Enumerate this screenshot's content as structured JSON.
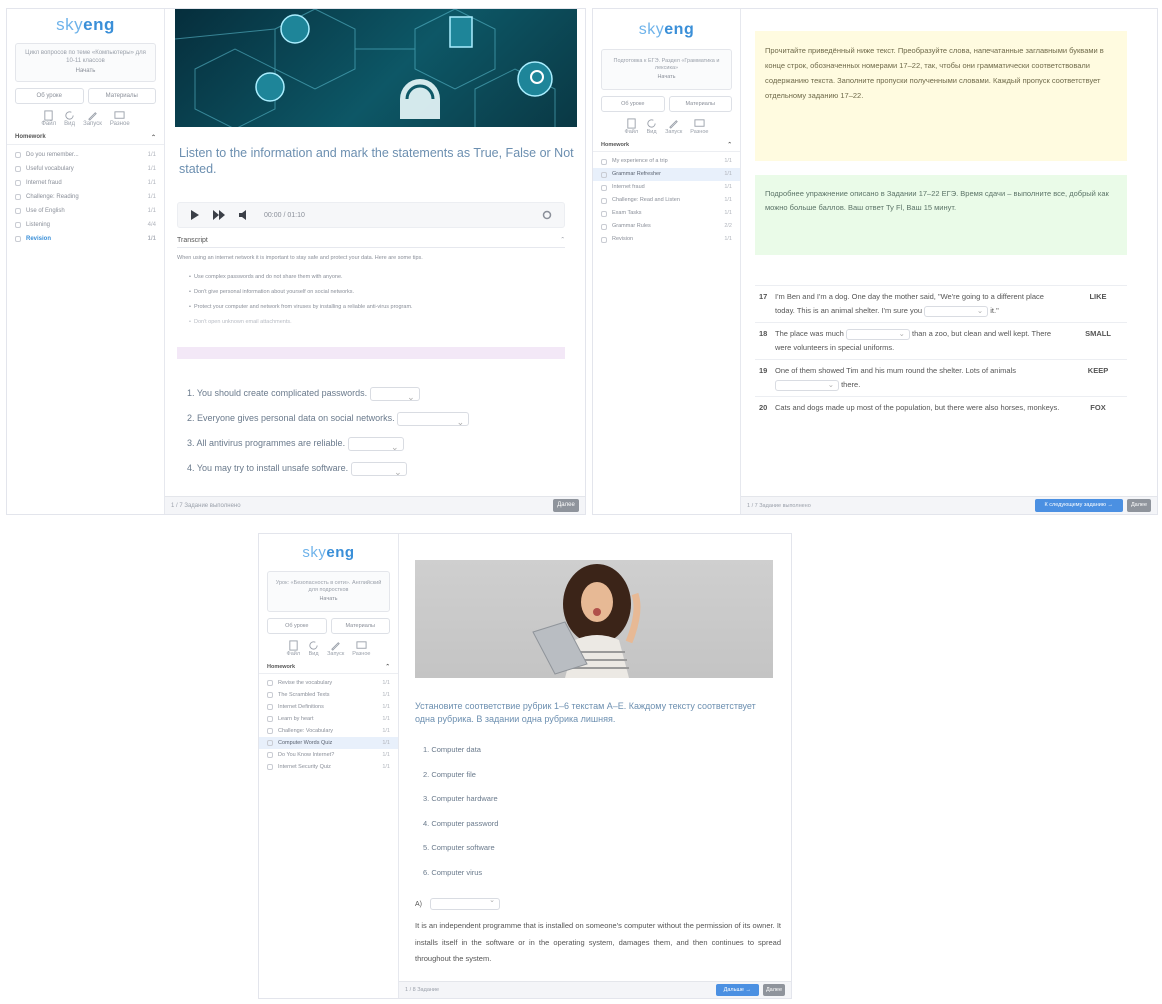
{
  "logo": {
    "sky": "sky",
    "eng": "eng"
  },
  "screen1": {
    "sidebar": {
      "card_text": "Цикл вопросов по теме «Компьютеры» для 10-11 классов",
      "card_link": "Начать",
      "btn_left": "Об уроке",
      "btn_right": "Материалы",
      "icons": [
        "Файл",
        "Вид",
        "Запуск",
        "Разное"
      ],
      "section": "Homework",
      "items": [
        {
          "label": "Do you remember...",
          "n": "1/1"
        },
        {
          "label": "Useful vocabulary",
          "n": "1/1"
        },
        {
          "label": "Internet fraud",
          "n": "1/1"
        },
        {
          "label": "Challenge: Reading",
          "n": "1/1"
        },
        {
          "label": "Use of English",
          "n": "1/1"
        },
        {
          "label": "Listening",
          "n": "4/4"
        },
        {
          "label": "Revision",
          "n": "1/1"
        }
      ]
    },
    "instruction": "Listen to the information and mark the statements as True, False or Not stated.",
    "audio_time": "00:00 / 01:10",
    "transcript_title": "Transcript",
    "transcript_text": "When using an internet network it is important to stay safe and protect your data. Here are some tips.",
    "bullets": [
      "Use complex passwords and do not share them with anyone.",
      "Don't give personal information about yourself on social networks.",
      "Protect your computer and network from viruses by installing a reliable anti-virus program.",
      "Don't open unknown email attachments."
    ],
    "statements": [
      "1. You should create complicated passwords.",
      "2. Everyone gives personal data on social networks.",
      "3. All antivirus programmes are reliable.",
      "4. You may try to install unsafe software."
    ],
    "footer_text": "1 / 7 Задание выполнено",
    "footer_btn": "Далее"
  },
  "screen2": {
    "sidebar": {
      "card_text": "Подготовка к ЕГЭ. Раздел «Грамматика и лексика»",
      "card_link": "Начать",
      "btn_left": "Об уроке",
      "btn_right": "Материалы",
      "icons": [
        "Файл",
        "Вид",
        "Запуск",
        "Разное"
      ],
      "section": "Homework",
      "items": [
        {
          "label": "My experience of a trip",
          "n": "1/1"
        },
        {
          "label": "Grammar Refresher",
          "n": "1/1"
        },
        {
          "label": "Internet fraud",
          "n": "1/1"
        },
        {
          "label": "Challenge: Read and Listen",
          "n": "1/1"
        },
        {
          "label": "Exam Tasks",
          "n": "1/1"
        },
        {
          "label": "Grammar Rules",
          "n": "2/2"
        },
        {
          "label": "Revision",
          "n": "1/1"
        }
      ]
    },
    "yellow_text": "Прочитайте приведённый ниже текст. Преобразуйте слова, напечатанные заглавными буквами в конце строк, обозначенных номерами 17–22, так, чтобы они грамматически соответствовали содержанию текста. Заполните пропуски полученными словами. Каждый пропуск соответствует отдельному заданию 17–22.",
    "green_text": "Подробнее упражнение описано в Задании 17–22 ЕГЭ. Время сдачи – выполните все, добрый как можно больше баллов. Ваш ответ Ту Fl, Ваш 15 минут.",
    "rows": [
      {
        "num": "17",
        "text": "I'm Ben and I'm a dog. One day the mother said, \"We're going to a different place today. This is an animal shelter. I'm sure you",
        "tail": "it.\"",
        "word": "LIKE"
      },
      {
        "num": "18",
        "text": "The place was much",
        "tail": "than a zoo, but clean and well kept. There were volunteers in special uniforms.",
        "word": "SMALL"
      },
      {
        "num": "19",
        "text": "One of them showed Tim and his mum round the shelter. Lots of animals",
        "tail": "there.",
        "word": "KEEP"
      },
      {
        "num": "20",
        "text": "Cats and dogs made up most of the population, but there were also horses, monkeys.",
        "tail": "",
        "word": "FOX"
      }
    ],
    "footer_text": "1 / 7 Задание выполнено",
    "footer_blue": "К следующему заданию →",
    "footer_btn": "Далее"
  },
  "screen3": {
    "sidebar": {
      "card_text": "Урок: «Безопасность в сети». Английский для подростков",
      "card_link": "Начать",
      "btn_left": "Об уроке",
      "btn_right": "Материалы",
      "icons": [
        "Файл",
        "Вид",
        "Запуск",
        "Разное"
      ],
      "section": "Homework",
      "items": [
        {
          "label": "Revise the vocabulary",
          "n": "1/1"
        },
        {
          "label": "The Scrambled Texts",
          "n": "1/1"
        },
        {
          "label": "Internet Definitions",
          "n": "1/1"
        },
        {
          "label": "Learn by heart",
          "n": "1/1"
        },
        {
          "label": "Challenge: Vocabulary",
          "n": "1/1"
        },
        {
          "label": "Computer Words Quiz",
          "n": "1/1"
        },
        {
          "label": "Do You Know Internet?",
          "n": "1/1"
        },
        {
          "label": "Internet Security Quiz",
          "n": "1/1"
        }
      ]
    },
    "instruction": "Установите соответствие рубрик 1–6 текстам A–E. Каждому тексту соответствует одна рубрика. В задании одна рубрика лишняя.",
    "options": [
      "1. Computer data",
      "2. Computer file",
      "3. Computer hardware",
      "4. Computer password",
      "5. Computer software",
      "6. Computer virus"
    ],
    "select_label": "A)",
    "paragraph": "It is an independent programme that is installed on someone's computer without the permission of its owner. It installs itself in the software or in the operating system, damages them, and then continues to spread throughout the system.",
    "footer_text": "1 / 8 Задание",
    "footer_blue": "Дальше →",
    "footer_btn": "Далее"
  }
}
